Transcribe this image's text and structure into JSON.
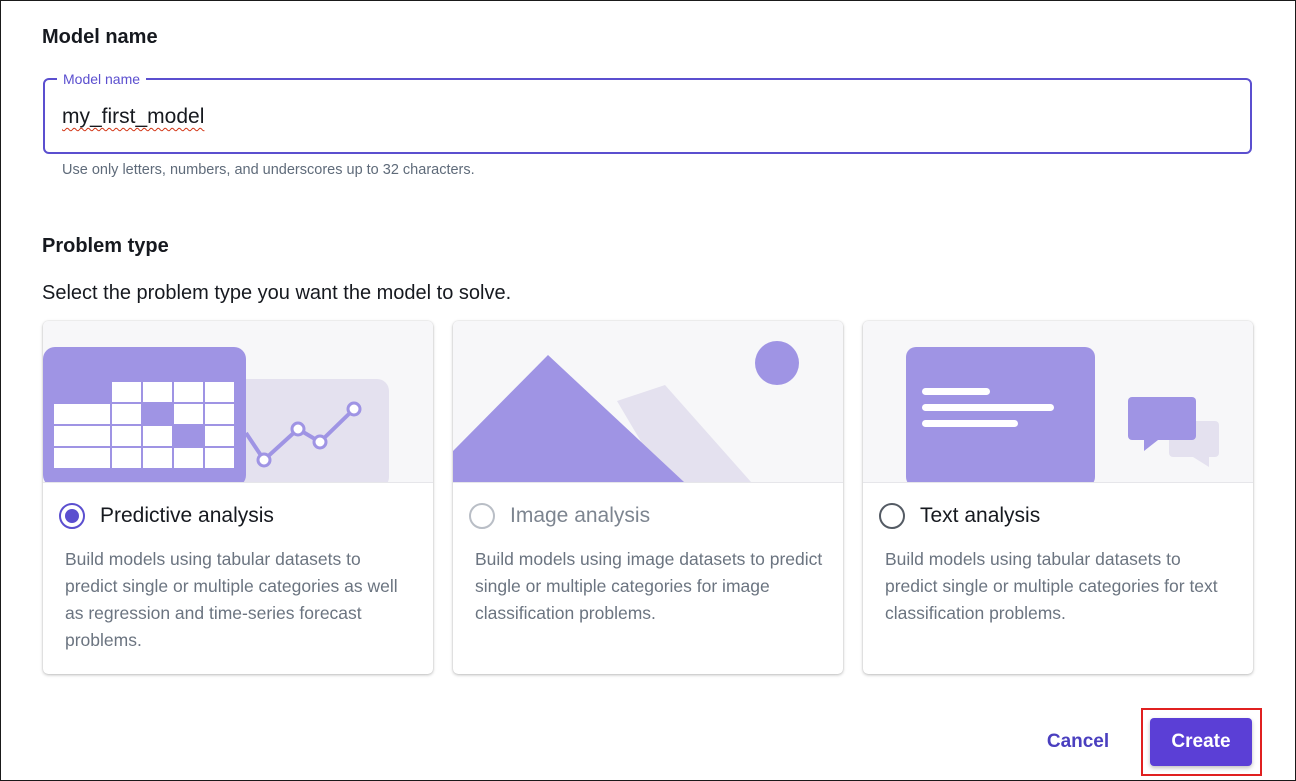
{
  "model_name_section": {
    "title": "Model name",
    "field_label": "Model name",
    "field_value": "my_first_model",
    "hint": "Use only letters, numbers, and underscores up to 32 characters."
  },
  "problem_type_section": {
    "title": "Problem type",
    "subtitle": "Select the problem type you want the model to solve.",
    "options": [
      {
        "title": "Predictive analysis",
        "description": "Build models using tabular datasets to predict single or multiple categories as well as regression and time-series forecast problems.",
        "selected": true,
        "disabled": false
      },
      {
        "title": "Image analysis",
        "description": "Build models using image datasets to predict single or multiple categories for image classification problems.",
        "selected": false,
        "disabled": true
      },
      {
        "title": "Text analysis",
        "description": "Build models using tabular datasets to predict single or multiple categories for text classification problems.",
        "selected": false,
        "disabled": false
      }
    ]
  },
  "actions": {
    "cancel_label": "Cancel",
    "create_label": "Create"
  },
  "colors": {
    "accent": "#5b4fcf",
    "primary_button": "#5b3fd6",
    "illustration_primary": "#9f94e4",
    "illustration_secondary": "#e4e1ef",
    "highlight": "#e02020"
  }
}
